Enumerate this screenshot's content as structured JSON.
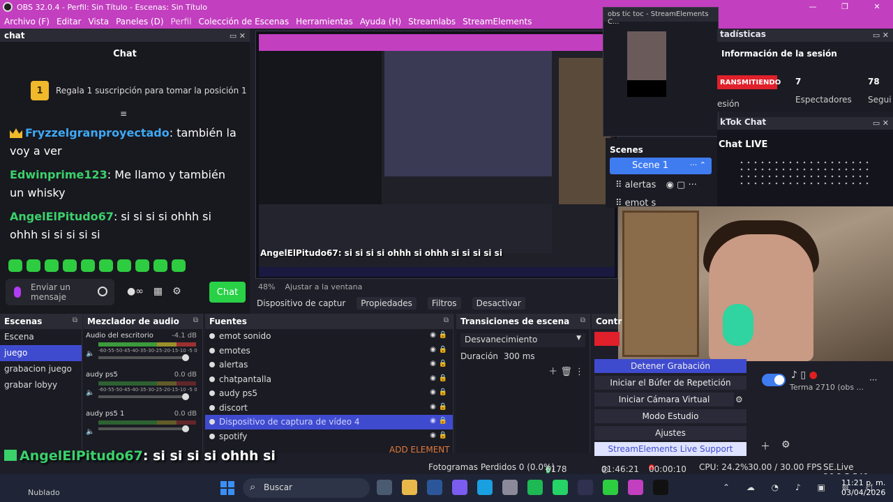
{
  "window": {
    "title": "OBS 32.0.4 - Perfil: Sin Título - Escenas: Sin Título",
    "controls": [
      "—",
      "❐",
      "✕"
    ]
  },
  "menu": [
    "Archivo (F)",
    "Editar",
    "Vista",
    "Paneles (D)",
    "Perfil",
    "Colección de Escenas",
    "Herramientas",
    "Ayuda (H)",
    "Streamlabs",
    "StreamElements"
  ],
  "chat_dock": {
    "header": "chat",
    "title": "Chat",
    "pinned_rank": "1",
    "pinned_text": "Regala 1 suscripción para tomar la posición 1",
    "messages": [
      {
        "user": "Fryzzelgranproyectado",
        "text": ": también la voy a ver"
      },
      {
        "user": "Edwinprime123",
        "text": ": Me llamo y también un whisky"
      },
      {
        "user": "AngelElPitudo67",
        "text": ": si si si si ohhh si ohhh si si si si si"
      }
    ],
    "input_placeholder": "Enviar un mensaje",
    "send_label": "Chat"
  },
  "preview": {
    "overlay_user": "AngelElPitudo67",
    "overlay_text": ": si si si si ohhh si ohhh si si si si si",
    "zoom": "48%",
    "fit_label": "Ajustar a la ventana"
  },
  "source_toolbar": {
    "source_name": "Dispositivo de captur",
    "properties": "Propiedades",
    "filters": "Filtros",
    "deactivate": "Desactivar"
  },
  "se_window": {
    "title": "obs tic toc - StreamElements C..."
  },
  "stats": {
    "header": "tadísticas",
    "info": "Información de la sesión",
    "live": "RANSMITIENDO",
    "viewers": "7",
    "viewers_label": "Espectadores",
    "followers": "78",
    "followers_label": "Segui",
    "session_label": "esión"
  },
  "tiktok_chat": {
    "header": "kTok Chat",
    "title": "Chat LIVE"
  },
  "scenes_overlay": {
    "title": "Scenes",
    "active": "Scene 1",
    "items": [
      "alertas",
      "emot s"
    ]
  },
  "scenes_dock": {
    "header": "Escenas",
    "items": [
      "Escena",
      "juego",
      "grabacion juego",
      "grabar lobyy"
    ],
    "selected": 1
  },
  "mixer": {
    "header": "Mezclador de audio",
    "channels": [
      {
        "name": "Audio del escritorio",
        "db": "-4.1 dB"
      },
      {
        "name": "audy ps5",
        "db": "0.0 dB"
      },
      {
        "name": "audy ps5 1",
        "db": "0.0 dB"
      }
    ],
    "ticks": "-60-55-50-45-40-35-30-25-20-15-10 -5 0"
  },
  "sources": {
    "header": "Fuentes",
    "items": [
      "emot sonido",
      "emotes",
      "alertas",
      "chatpantalla",
      "audy ps5",
      "discort",
      "Dispositivo de captura de vídeo 4",
      "spotify"
    ],
    "selected": 6,
    "add_label": "ADD ELEMENT"
  },
  "transitions": {
    "header": "Transiciones de escena",
    "selected": "Desvanecimiento",
    "duration_label": "Duración",
    "duration_value": "300 ms"
  },
  "controls": {
    "header": "Contr",
    "buttons": [
      "Detener Grabación",
      "Iniciar el Búfer de Repetición",
      "Iniciar Cámara Virtual",
      "Modo Estudio",
      "Ajustes",
      "StreamElements Live Support"
    ]
  },
  "tiktok_dock": {
    "account": "Terma 2710 (obs ..."
  },
  "statusbar": {
    "dropped": "Fotogramas Perdidos 0 (0.0%)",
    "bitrate": "6178 kbps",
    "stream_time": "01:46:21",
    "rec_time": "00:00:10",
    "cpu": "CPU: 24.2%",
    "fps": "30.00 / 30.00 FPS",
    "se_version": "SE.Live 26.2.5.549"
  },
  "overlay_chat": {
    "user": "AngelElPitudo67",
    "line1": ": si si si si ohhh si",
    "line2": "ohhh si si si si si"
  },
  "taskbar": {
    "weather": "Nublado",
    "search": "Buscar",
    "time": "11:21 p. m.",
    "date": "03/04/2026"
  },
  "colors": {
    "titlebar": "#c23fbf",
    "accent_blue": "#3f4bcf",
    "live_red": "#e0202b",
    "chat_green": "#29d147"
  }
}
